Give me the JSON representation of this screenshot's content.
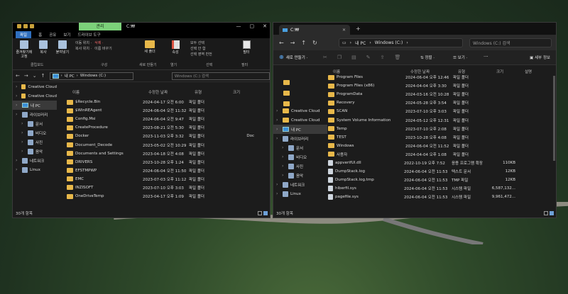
{
  "left": {
    "titlebar": {
      "context_tab": "관리",
      "title": "C:₩",
      "controls": [
        "—",
        "▢",
        "✕"
      ]
    },
    "ribbon_tabs": [
      "파일",
      "홈",
      "공유",
      "보기",
      "드라이브 도구"
    ],
    "ribbon": {
      "pin": "즐겨찾기에 고정",
      "copy": "복사",
      "paste": "붙여넣기",
      "clipboard_group": "클립보드",
      "move_to": "이동 위치 ·",
      "copy_to": "복사 위치 ·",
      "delete": "삭제 ·",
      "rename": "이름 바꾸기",
      "organize_group": "구성",
      "new_folder": "새 폴더",
      "new_group": "새로 만들기",
      "properties": "속성",
      "open_group": "열기",
      "select_all": "모두 선택",
      "select_none": "선택 안 함",
      "invert": "선택 영역 반전",
      "select_group": "선택",
      "filter": "필터",
      "filter_group": "필터"
    },
    "breadcrumb": [
      "내 PC",
      "Windows (C:)"
    ],
    "search_placeholder": "Windows (C:) 검색",
    "nav": [
      {
        "label": "Creative Cloud",
        "icon": "folder-icon"
      },
      {
        "label": "Creative Cloud",
        "icon": "folder-icon"
      },
      {
        "label": "내 PC",
        "icon": "pc-icon"
      },
      {
        "label": "라이브러리",
        "icon": "library-icon"
      },
      {
        "label": "문서",
        "icon": "documents-icon"
      },
      {
        "label": "비디오",
        "icon": "video-icon"
      },
      {
        "label": "사진",
        "icon": "pictures-icon"
      },
      {
        "label": "음악",
        "icon": "music-icon"
      },
      {
        "label": "네트워크",
        "icon": "network-icon"
      },
      {
        "label": "Linux",
        "icon": "linux-icon"
      }
    ],
    "columns": [
      "이름",
      "수정한 날짜",
      "유형",
      "크기"
    ],
    "files": [
      {
        "name": "$Recycle.Bin",
        "date": "2024-04-17 오전 6:00",
        "type": "파일 폴더",
        "size": ""
      },
      {
        "name": "$WinREAgent",
        "date": "2024-06-04 오전 11:32",
        "type": "파일 폴더",
        "size": ""
      },
      {
        "name": "Config.Msi",
        "date": "2024-06-04 오전 9:47",
        "type": "파일 폴더",
        "size": ""
      },
      {
        "name": "CreateProcedure",
        "date": "2023-08-21 오전 5:30",
        "type": "파일 폴더",
        "size": ""
      },
      {
        "name": "Docker",
        "date": "2023-11-03 오후 3:32",
        "type": "파일 폴더",
        "size": "Doc"
      },
      {
        "name": "Document_Decode",
        "date": "2023-05-02 오전 10:29",
        "type": "파일 폴더",
        "size": ""
      },
      {
        "name": "Documents and Settings",
        "date": "2023-04-18 오전 4:08",
        "type": "파일 폴더",
        "size": ""
      },
      {
        "name": "DRIVERS",
        "date": "2023-10-28 오후 1:24",
        "type": "파일 폴더",
        "size": ""
      },
      {
        "name": "EFSTMPWP",
        "date": "2024-06-04 오전 11:50",
        "type": "파일 폴더",
        "size": ""
      },
      {
        "name": "EMC",
        "date": "2023-07-03 오후 11:12",
        "type": "파일 폴더",
        "size": ""
      },
      {
        "name": "INZISOFT",
        "date": "2023-07-10 오후 3:03",
        "type": "파일 폴더",
        "size": ""
      },
      {
        "name": "OneDriveTemp",
        "date": "2023-04-17 오후 1:09",
        "type": "파일 폴더",
        "size": ""
      }
    ],
    "status": "30개 항목"
  },
  "right": {
    "tab_title": "C:₩",
    "breadcrumb": [
      "내 PC",
      "Windows (C:)"
    ],
    "search_placeholder": "Windows (C:) 검색",
    "cmd": {
      "new": "새로 만들기 ·",
      "sort": "정렬 ·",
      "view": "보기 ·",
      "more": "···",
      "details": "세부 정보"
    },
    "nav": [
      {
        "label": "Creative Cloud",
        "icon": "folder-icon"
      },
      {
        "label": "Creative Cloud",
        "icon": "folder-icon"
      },
      {
        "label": "내 PC",
        "icon": "pc-icon"
      },
      {
        "label": "라이브러리",
        "icon": "library-icon"
      },
      {
        "label": "문서",
        "icon": "documents-icon"
      },
      {
        "label": "비디오",
        "icon": "video-icon"
      },
      {
        "label": "사진",
        "icon": "pictures-icon"
      },
      {
        "label": "음악",
        "icon": "music-icon"
      },
      {
        "label": "네트워크",
        "icon": "network-icon"
      },
      {
        "label": "Linux",
        "icon": "linux-icon"
      }
    ],
    "columns": [
      "이름",
      "수정한 날짜",
      "유형",
      "크기",
      "설명"
    ],
    "files": [
      {
        "name": "Program Files",
        "date": "2024-06-04 오후 12:46",
        "type": "파일 폴더",
        "size": "",
        "kind": "folder"
      },
      {
        "name": "Program Files (x86)",
        "date": "2024-04-04 오후 3:30",
        "type": "파일 폴더",
        "size": "",
        "kind": "folder"
      },
      {
        "name": "ProgramData",
        "date": "2024-03-16 오전 10:28",
        "type": "파일 폴더",
        "size": "",
        "kind": "folder"
      },
      {
        "name": "Recovery",
        "date": "2024-05-28 오후 3:54",
        "type": "파일 폴더",
        "size": "",
        "kind": "folder"
      },
      {
        "name": "SCAN",
        "date": "2023-07-10 오후 3:03",
        "type": "파일 폴더",
        "size": "",
        "kind": "folder"
      },
      {
        "name": "System Volume Information",
        "date": "2024-05-12 오후 12:31",
        "type": "파일 폴더",
        "size": "",
        "kind": "folder"
      },
      {
        "name": "Temp",
        "date": "2023-07-10 오후 2:08",
        "type": "파일 폴더",
        "size": "",
        "kind": "folder"
      },
      {
        "name": "TEST",
        "date": "2023-10-28 오후 4:08",
        "type": "파일 폴더",
        "size": "",
        "kind": "folder"
      },
      {
        "name": "Windows",
        "date": "2024-06-04 오전 11:52",
        "type": "파일 폴더",
        "size": "",
        "kind": "folder"
      },
      {
        "name": "사용자",
        "date": "2024-04-04 오후 1:08",
        "type": "파일 폴더",
        "size": "",
        "kind": "folder"
      },
      {
        "name": "appverifUI.dll",
        "date": "2022-10-19 오후 7:52",
        "type": "응용 프로그램 확장",
        "size": "110KB",
        "kind": "file"
      },
      {
        "name": "DumpStack.log",
        "date": "2024-06-04 오전 11:53",
        "type": "텍스트 문서",
        "size": "12KB",
        "kind": "file"
      },
      {
        "name": "DumpStack.log.tmp",
        "date": "2024-06-04 오전 11:53",
        "type": "TMP 파일",
        "size": "12KB",
        "kind": "file"
      },
      {
        "name": "hiberfil.sys",
        "date": "2024-06-04 오전 11:53",
        "type": "시스템 파일",
        "size": "6,587,132...",
        "kind": "file"
      },
      {
        "name": "pagefile.sys",
        "date": "2024-06-04 오전 11:53",
        "type": "시스템 파일",
        "size": "9,961,472...",
        "kind": "file"
      }
    ],
    "status": "30개 항목"
  }
}
